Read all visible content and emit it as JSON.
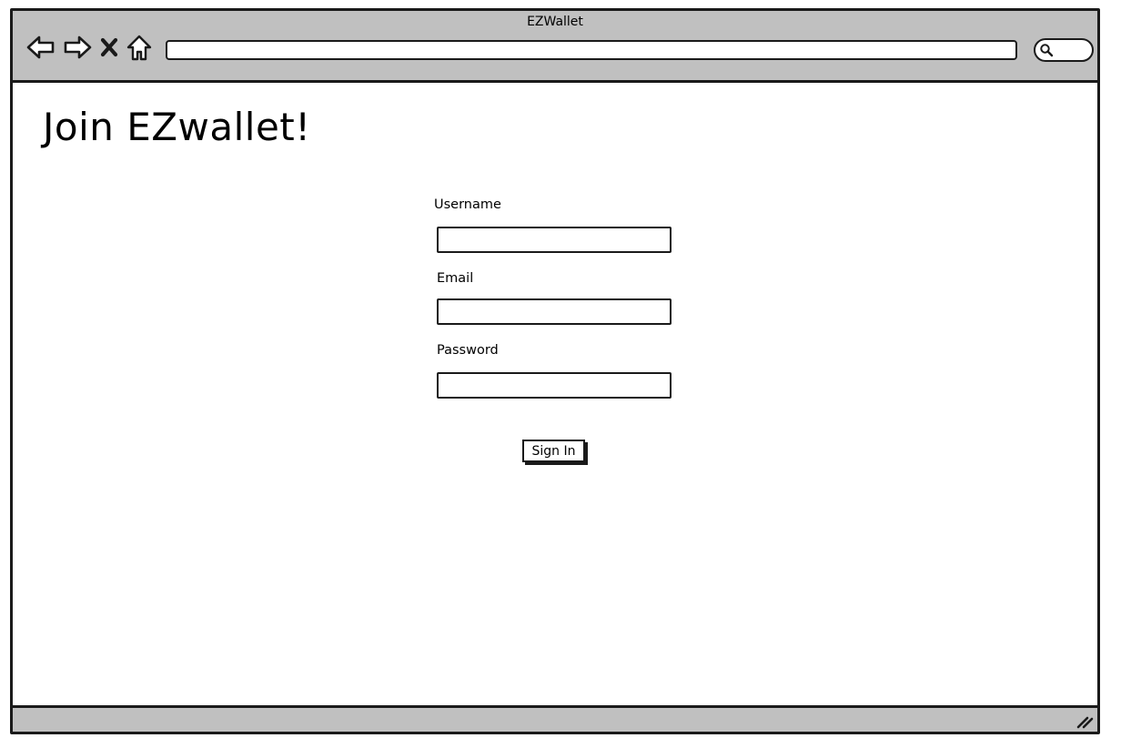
{
  "window": {
    "title": "EZWallet"
  },
  "toolbar": {
    "icons": [
      "back-arrow-icon",
      "forward-arrow-icon",
      "stop-icon",
      "home-icon",
      "search-icon"
    ],
    "address_value": ""
  },
  "page": {
    "heading": "Join EZwallet!"
  },
  "form": {
    "username_label": "Username",
    "username_value": "",
    "email_label": "Email",
    "email_value": "",
    "password_label": "Password",
    "password_value": "",
    "submit_label": "Sign In"
  },
  "colors": {
    "chrome": "#c0c0c0",
    "stroke": "#1a1a1a",
    "background": "#ffffff"
  }
}
